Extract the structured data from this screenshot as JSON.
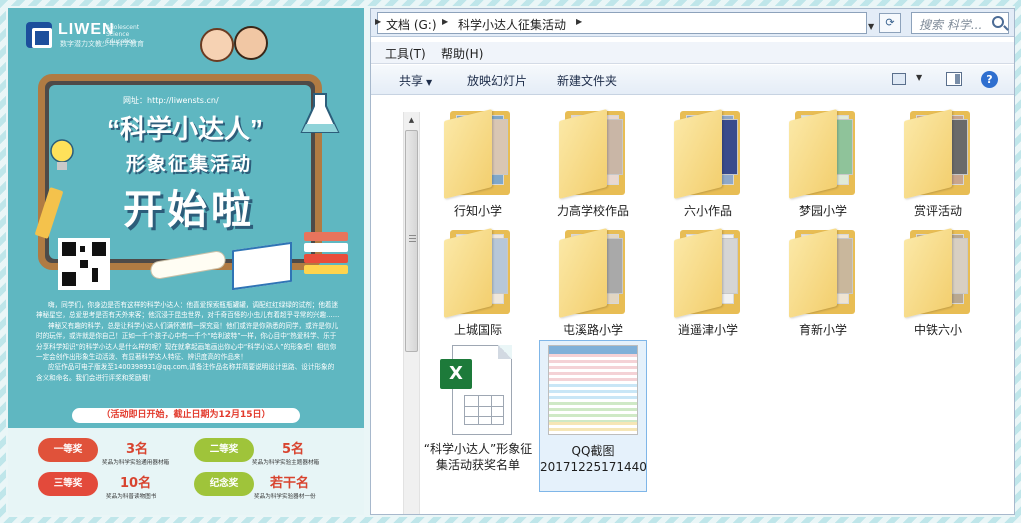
{
  "poster": {
    "brand": "LIWEN",
    "brand_sub": "数字潜力文教少年科学教育",
    "brand_tag": "Adolescent Science Education",
    "url": "网址：http://liwensts.cn/",
    "title1": "“科学小达人”",
    "title2": "形象征集活动",
    "title3": "开始啦",
    "body": [
      "嗨，同学们，你身边是否有这样的科学小达人：他喜爱探索瓶瓶罐罐，调配红红绿绿的试剂；他着迷神秘星空，总爱思考是否有天外来客；他沉浸于昆虫世界，对千奇百怪的小虫儿有着超乎寻常的兴趣……",
      "神秘又有趣的科学，总是让科学小达人们满怀激情一探究竟！他们或许是你熟悉的同学，或许是你儿时的玩伴，或许就是你自己！正如一千个孩子心中有一千个“哈利波特”一样，你心目中“热爱科学、乐于分享科学知识”的科学小达人是什么样的呢？现在就拿起画笔画出你心中“科学小达人”的形象吧！相信你一定会创作出形象生动活泼、有显著科学达人特征、辨识度高的作品来！",
      "应征作品可电子版发至1400398931@qq.com,请备注作品名称并简要说明设计思路、设计形象的含义和命名。我们会进行评奖和奖励哦！"
    ],
    "deadline": "（活动即日开始，截止日期为12月15日）",
    "awards": [
      {
        "name": "一等奖",
        "count": "3名",
        "desc": "奖品为科学实验通用器材箱",
        "color": "#e0523a"
      },
      {
        "name": "二等奖",
        "count": "5名",
        "desc": "奖品为科学实验主题器材箱",
        "color": "#9fc43a"
      },
      {
        "name": "三等奖",
        "count": "10名",
        "desc": "奖品为科普读物图书",
        "color": "#e34a3b"
      },
      {
        "name": "纪念奖",
        "count": "若干名",
        "desc": "奖品为科学实验器材一份",
        "color": "#9fc43a"
      }
    ]
  },
  "explorer": {
    "address": {
      "segments": [
        "文档 (G:)",
        "科学小达人征集活动"
      ],
      "search_placeholder": "搜索 科学..."
    },
    "menu": {
      "tools": "工具(T)",
      "help": "帮助(H)"
    },
    "toolbar": {
      "share": "共享",
      "slideshow": "放映幻灯片",
      "new_folder": "新建文件夹"
    },
    "items": [
      {
        "label": "行知小学",
        "kind": "folder"
      },
      {
        "label": "力高学校作品",
        "kind": "folder"
      },
      {
        "label": "六小作品",
        "kind": "folder"
      },
      {
        "label": "梦园小学",
        "kind": "folder"
      },
      {
        "label": "赏评活动",
        "kind": "folder"
      },
      {
        "label": "上城国际",
        "kind": "folder"
      },
      {
        "label": "屯溪路小学",
        "kind": "folder"
      },
      {
        "label": "逍遥津小学",
        "kind": "folder"
      },
      {
        "label": "育新小学",
        "kind": "folder"
      },
      {
        "label": "中铁六小",
        "kind": "folder"
      },
      {
        "label": "“科学小达人”形象征集活动获奖名单",
        "kind": "xlsx"
      },
      {
        "label": "QQ截图20171225171440",
        "kind": "image"
      }
    ]
  },
  "colors": {
    "poster_bg": "#5fb7c1",
    "folder": "#f3cf6f",
    "excel": "#1d7a3a",
    "selection": "#e5f1fb"
  }
}
